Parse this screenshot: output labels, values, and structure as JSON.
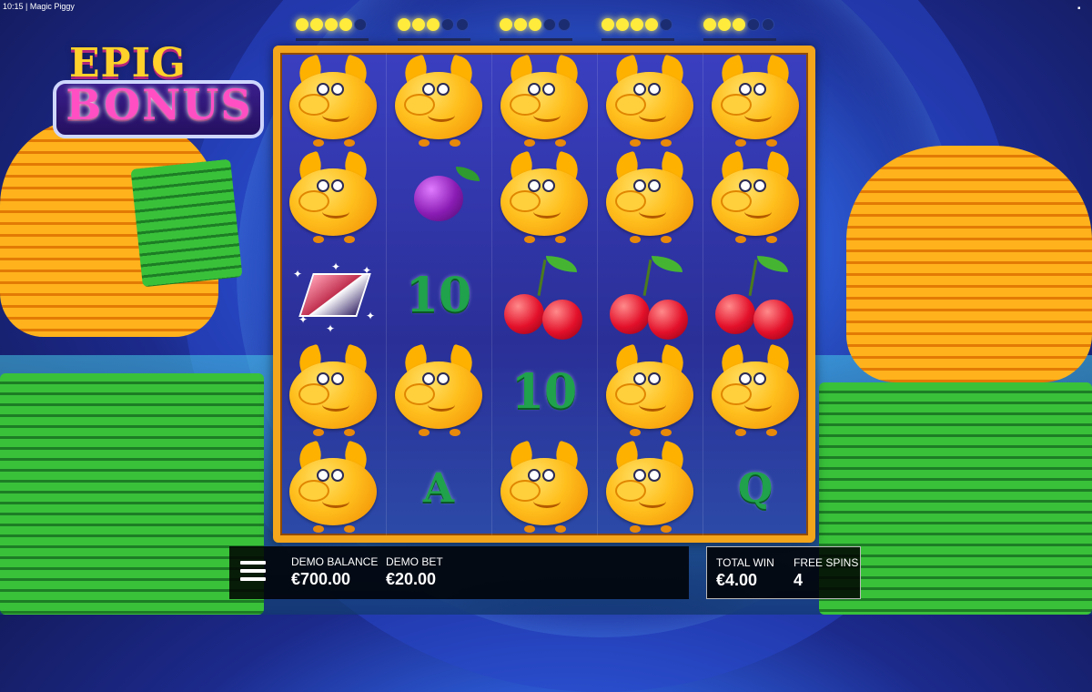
{
  "status_bar": {
    "time": "10:15",
    "separator": "|",
    "app_title": "Magic Piggy"
  },
  "logo": {
    "top": "EPIG",
    "bottom": "BONUS"
  },
  "bonus_lights": [
    {
      "lit": 4,
      "total": 5
    },
    {
      "lit": 3,
      "total": 5
    },
    {
      "lit": 3,
      "total": 5
    },
    {
      "lit": 4,
      "total": 5
    },
    {
      "lit": 3,
      "total": 5
    }
  ],
  "reels": {
    "columns": 5,
    "rows": 5,
    "grid": [
      [
        "pig",
        "pig",
        "pig",
        "pig",
        "pig"
      ],
      [
        "pig",
        "plum",
        "pig",
        "pig",
        "pig"
      ],
      [
        "wild",
        "10",
        "cherries",
        "cherries",
        "cherries"
      ],
      [
        "pig",
        "pig",
        "10",
        "pig",
        "pig"
      ],
      [
        "pig",
        "A",
        "pig",
        "pig",
        "Q"
      ]
    ]
  },
  "bottom_bar": {
    "menu_icon": "hamburger-menu-icon",
    "balance_label": "DEMO BALANCE",
    "balance_value": "€700.00",
    "bet_label": "DEMO BET",
    "bet_value": "€20.00",
    "total_win_label": "TOTAL WIN",
    "total_win_value": "€4.00",
    "free_spins_label": "FREE SPINS",
    "free_spins_value": "4"
  },
  "colors": {
    "frame": "#f3a51b",
    "lit_bulb": "#ffeb3b",
    "symbol_green": "#1fa24b"
  }
}
